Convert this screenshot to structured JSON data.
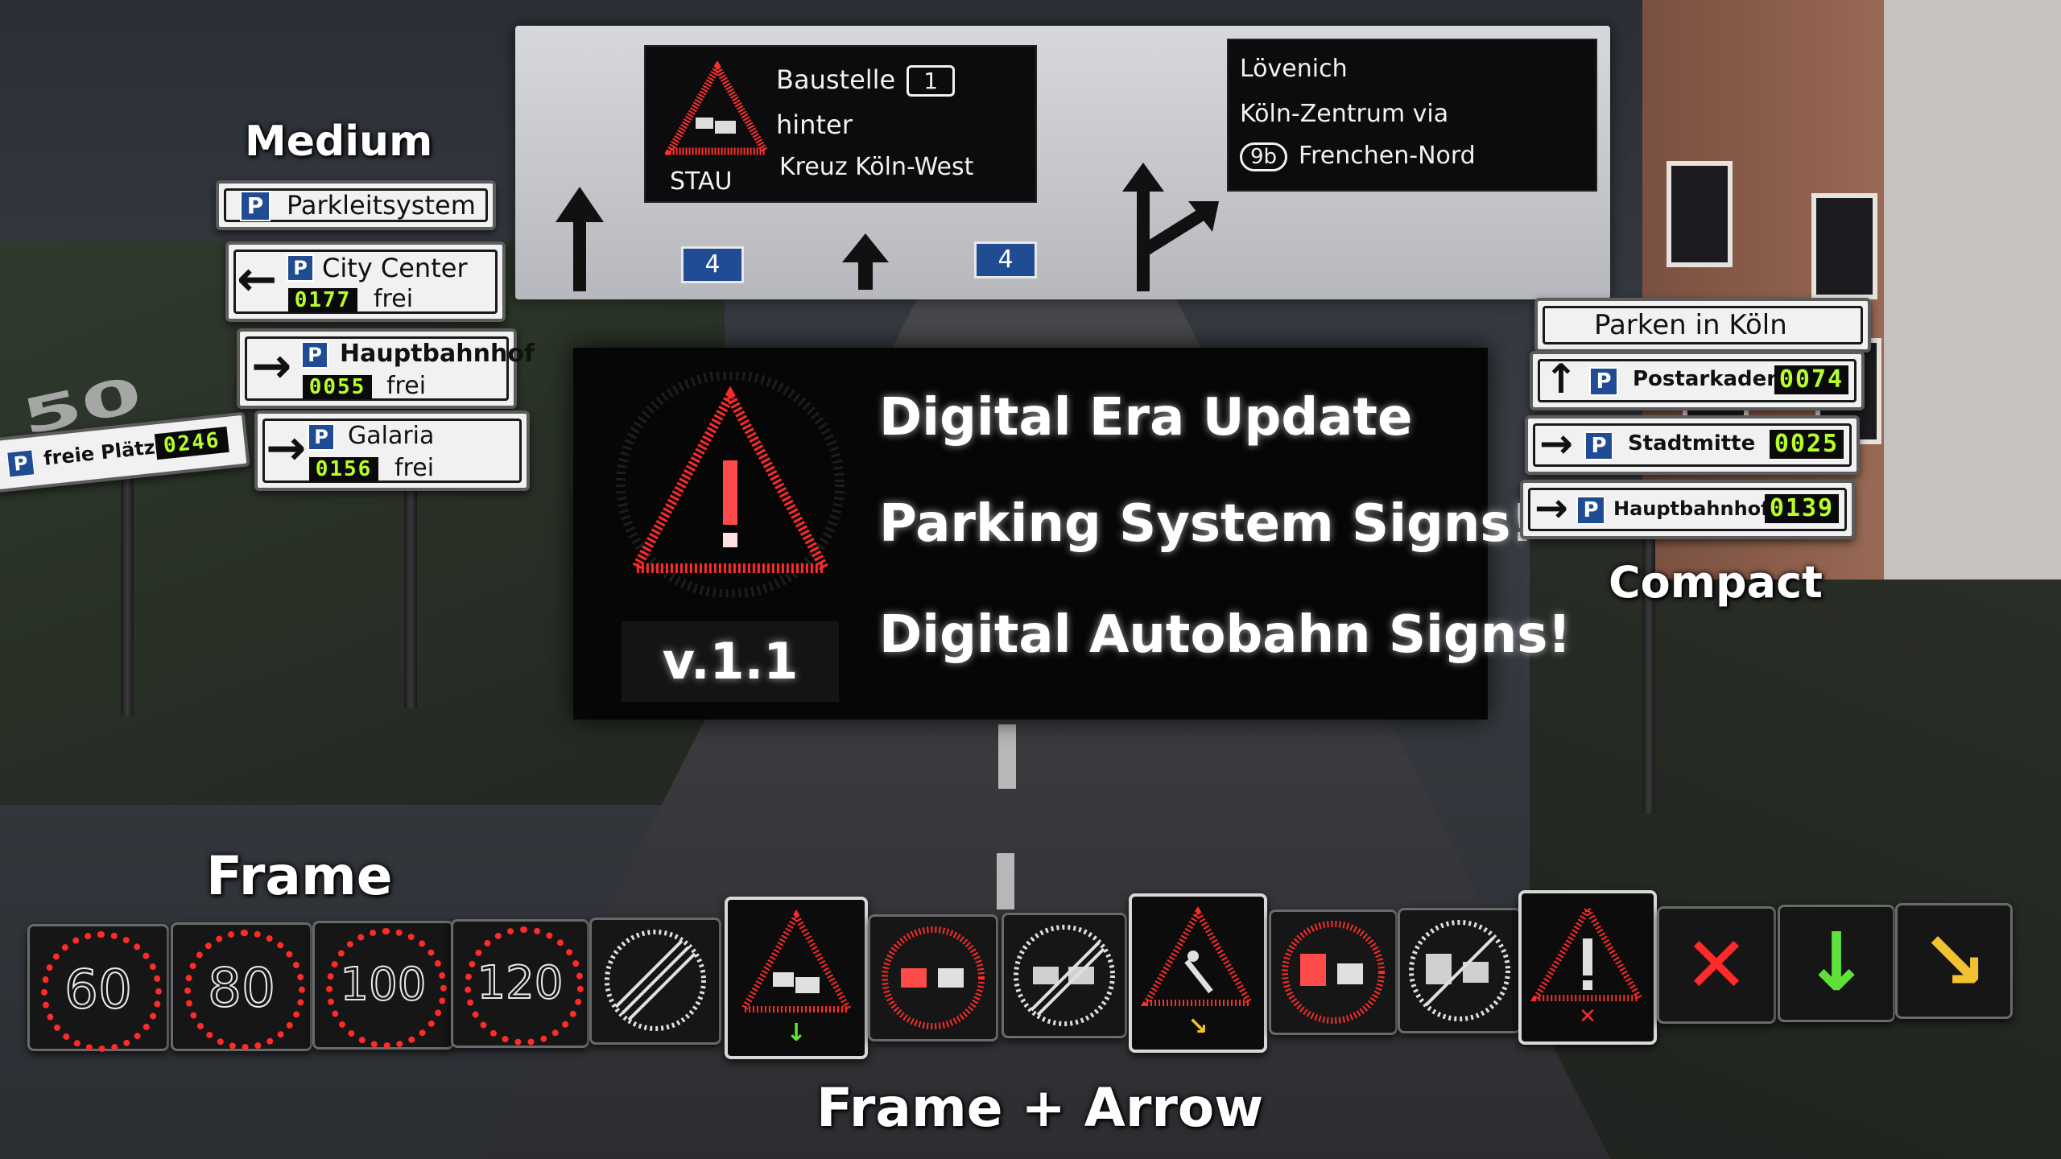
{
  "gantry": {
    "left_panel": {
      "line1": "Baustelle",
      "line1_box": "1",
      "line2": "hinter",
      "line3": "Kreuz Köln-West",
      "stau": "STAU"
    },
    "right_panel": {
      "line1": "Lövenich",
      "line2": "Köln-Zentrum via",
      "exit_badge": "9b",
      "line3": "Frenchen-Nord"
    },
    "lane_badges": [
      "4",
      "4"
    ]
  },
  "banner": {
    "lines": [
      "Digital Era Update",
      "Parking System Signs!",
      "Digital Autobahn Signs!"
    ],
    "version": "v.1.1"
  },
  "labels": {
    "medium": "Medium",
    "compact": "Compact",
    "frame": "Frame",
    "frame_arrow": "Frame + Arrow"
  },
  "medium_signs": {
    "header": "Parkleitsystem",
    "p_glyph": "P",
    "items": [
      {
        "name": "City Center",
        "count": "0177",
        "frei": "frei",
        "arrow": "←"
      },
      {
        "name": "Hauptbahnhof",
        "count": "0055",
        "frei": "frei",
        "arrow": "→"
      },
      {
        "name": "Galaria",
        "count": "0156",
        "frei": "frei",
        "arrow": "→"
      }
    ]
  },
  "left_sign": {
    "text": "freie Plätze",
    "count": "0246",
    "p_glyph": "P"
  },
  "compact_signs": {
    "header": "Parken in Köln",
    "items": [
      {
        "name": "Postarkaden",
        "count": "0074",
        "arrow": "↑"
      },
      {
        "name": "Stadtmitte",
        "count": "0025",
        "arrow": "→"
      },
      {
        "name": "Hauptbahnhof",
        "count": "0139",
        "arrow": "→"
      }
    ]
  },
  "road_marking": "50",
  "led_signs": [
    {
      "type": "speed",
      "value": "60"
    },
    {
      "type": "speed",
      "value": "80"
    },
    {
      "type": "speed",
      "value": "100"
    },
    {
      "type": "speed",
      "value": "120"
    },
    {
      "type": "end-restriction"
    },
    {
      "type": "warning-congestion",
      "sub_arrow": "↓"
    },
    {
      "type": "no-overtaking"
    },
    {
      "type": "end-no-overtaking"
    },
    {
      "type": "warning-roadworks",
      "sub_arrow": "↘"
    },
    {
      "type": "no-overtaking-trucks"
    },
    {
      "type": "end-no-overtaking-trucks"
    },
    {
      "type": "warning-general",
      "sub_arrow": "✕"
    },
    {
      "type": "lane-closed",
      "symbol": "✕"
    },
    {
      "type": "lane-open",
      "symbol": "↓"
    },
    {
      "type": "lane-change",
      "symbol": "↘"
    }
  ],
  "colors": {
    "led_red": "#ff2a2a",
    "led_green": "#5fe13a",
    "led_yellow": "#f2c230",
    "parking_blue": "#1f4c93",
    "counter_green": "#b7ff2a"
  }
}
